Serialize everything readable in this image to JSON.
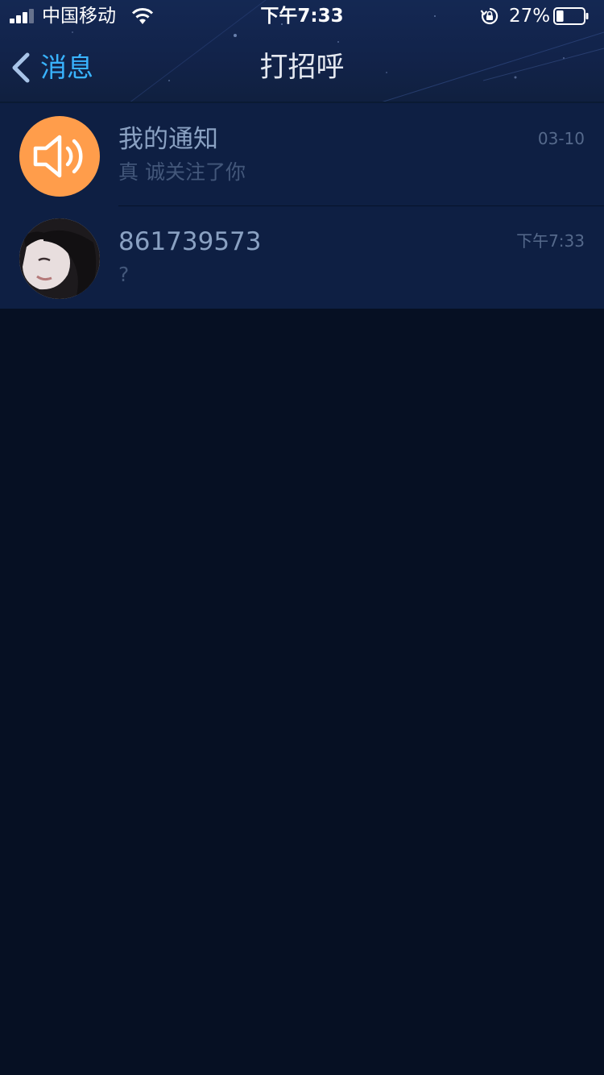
{
  "status_bar": {
    "carrier": "中国移动",
    "time": "下午7:33",
    "battery_percent": "27%",
    "battery_level": 0.27,
    "signal_bars": 3,
    "icons": [
      "signal-icon",
      "wifi-icon",
      "rotation-lock-icon",
      "battery-icon"
    ]
  },
  "nav": {
    "back_label": "消息",
    "title": "打招呼"
  },
  "messages": [
    {
      "title": "我的通知",
      "preview": "真 诚关注了你",
      "time": "03-10",
      "avatar": "speaker-icon",
      "avatar_color": "#ff9d4b"
    },
    {
      "title": "861739573",
      "preview": "?",
      "time": "下午7:33",
      "avatar": "user-photo"
    }
  ],
  "colors": {
    "header_bg": "#132750",
    "list_bg": "#0e1f43",
    "page_bg": "#061023",
    "accent": "#39b3ff",
    "title_text": "#8aa1c2",
    "sub_text": "#43577a"
  }
}
